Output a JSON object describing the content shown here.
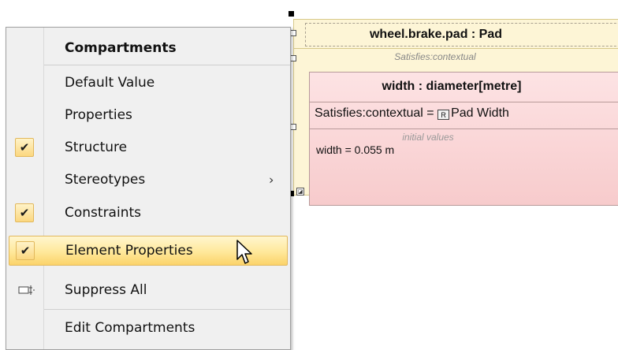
{
  "diagram": {
    "part_title": "wheel.brake.pad : Pad",
    "part_stereotype": "Satisfies:contextual",
    "value_property": {
      "title": "width : diameter[metre]",
      "satisfies_prefix": "Satisfies:contextual = ",
      "requirement_icon": "R",
      "requirement_name": "Pad Width",
      "initial_values_label": "initial values",
      "initial_value": "width = 0.055 m"
    }
  },
  "menu": {
    "header": "Compartments",
    "items": [
      {
        "label": "Default Value",
        "checked": false
      },
      {
        "label": "Properties",
        "checked": false
      },
      {
        "label": "Structure",
        "checked": true
      },
      {
        "label": "Stereotypes",
        "checked": false,
        "submenu": true
      },
      {
        "label": "Constraints",
        "checked": true
      },
      {
        "label": "Element Properties",
        "checked": true,
        "highlighted": true
      },
      {
        "label": "Suppress All",
        "icon": "suppress-all-icon"
      },
      {
        "label": "Edit Compartments"
      }
    ],
    "check_glyph": "✔",
    "submenu_glyph": "›"
  },
  "colors": {
    "menu_bg": "#f0f0f0",
    "highlight": "#ffe89a",
    "check_bg": "#fbd77f",
    "part_bg": "#fdf5d6",
    "value_prop_bg": "#f7cbcc"
  }
}
